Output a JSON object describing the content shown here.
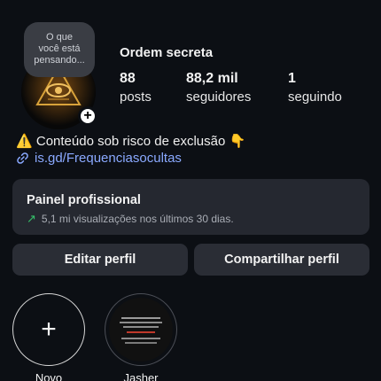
{
  "profile": {
    "username": "Ordem secreta",
    "note": [
      "O que",
      "você está",
      "pensando..."
    ],
    "stats": [
      {
        "value": "88",
        "label": "posts"
      },
      {
        "value": "88,2 mil",
        "label": "seguidores"
      },
      {
        "value": "1",
        "label": "seguindo"
      }
    ],
    "bio_emoji_start": "⚠️",
    "bio_text": "Conteúdo sob risco de exclusão",
    "bio_emoji_end": "👇",
    "link": "is.gd/Frequenciasocultas"
  },
  "panel": {
    "title": "Painel profissional",
    "subtitle": "5,1 mi visualizações nos últimos 30 dias."
  },
  "buttons": {
    "edit": "Editar perfil",
    "share": "Compartilhar perfil"
  },
  "highlights": [
    {
      "label": "Novo"
    },
    {
      "label": "Jasher"
    }
  ],
  "icons": {
    "add_badge": "plus-icon",
    "link": "link-icon",
    "trend": "trend-up-icon",
    "new_highlight": "plus-icon"
  },
  "colors": {
    "background": "#0c0f14",
    "panel": "#252830",
    "button": "#2a2d35",
    "link": "#8aa9ff",
    "trend": "#36c16a"
  }
}
